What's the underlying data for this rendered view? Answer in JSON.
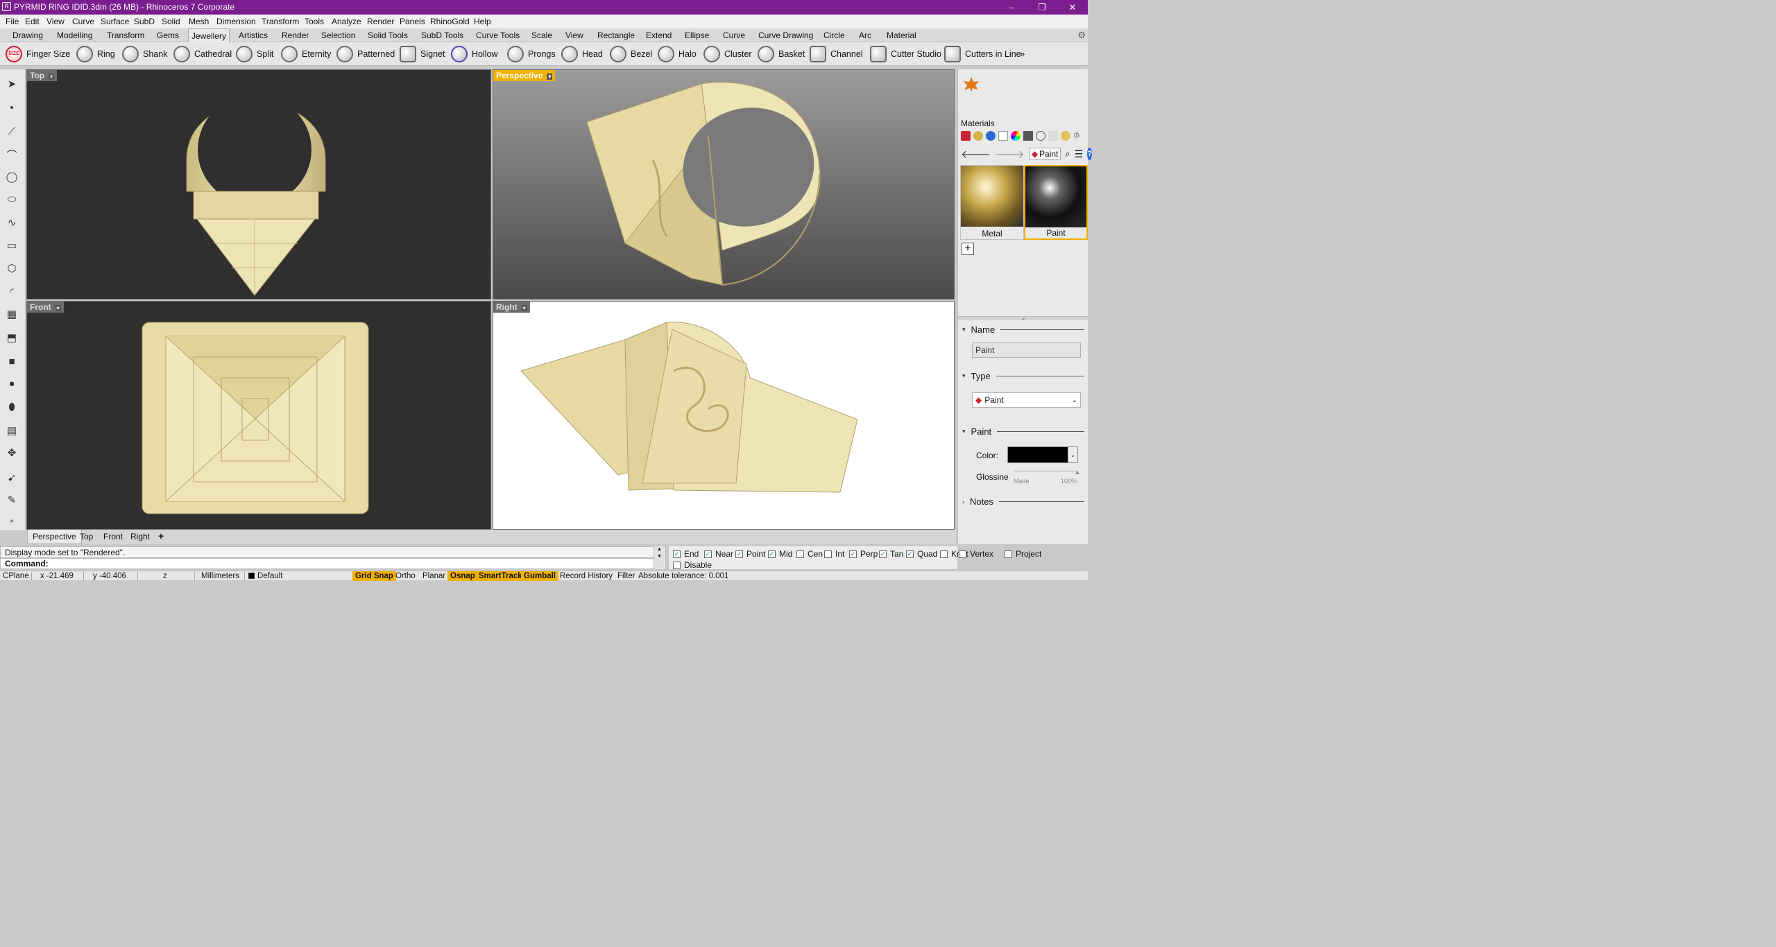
{
  "title_bar": {
    "title": "PYRMID RING IDID.3dm (26 MB) - Rhinoceros 7 Corporate",
    "minimize": "–",
    "maximize": "❐",
    "close": "✕"
  },
  "menu": [
    "File",
    "Edit",
    "View",
    "Curve",
    "Surface",
    "SubD",
    "Solid",
    "Mesh",
    "Dimension",
    "Transform",
    "Tools",
    "Analyze",
    "Render",
    "Panels",
    "RhinoGold",
    "Help"
  ],
  "toolbar_tabs": [
    "Drawing",
    "Modelling",
    "Transform",
    "Gems",
    "Jewellery",
    "Artistics",
    "Render",
    "Selection",
    "Solid Tools",
    "SubD Tools",
    "Curve Tools",
    "Scale",
    "View",
    "Rectangle",
    "Extend",
    "Ellipse",
    "Curve",
    "Curve Drawing",
    "Circle",
    "Arc",
    "Material"
  ],
  "active_tab": "Jewellery",
  "tools": [
    "Finger Size",
    "Ring",
    "Shank",
    "Cathedral",
    "Split",
    "Eternity",
    "Patterned",
    "Signet",
    "Hollow",
    "Prongs",
    "Head",
    "Bezel",
    "Halo",
    "Cluster",
    "Basket",
    "Channel",
    "Cutter Studio",
    "Cutters in Line"
  ],
  "tools_more": "»",
  "finger_size_badge": "SIZE",
  "viewports": {
    "top": {
      "title": "Top",
      "caret": "▾"
    },
    "perspective": {
      "title": "Perspective",
      "caret": "▾"
    },
    "front": {
      "title": "Front",
      "caret": "▾"
    },
    "right": {
      "title": "Right",
      "caret": "▾"
    }
  },
  "viewport_tabs": [
    "Perspective",
    "Top",
    "Front",
    "Right"
  ],
  "viewport_tab_add": "+",
  "command": {
    "history": "Display mode set to \"Rendered\".",
    "prompt": "Command:"
  },
  "osnap": {
    "items": [
      {
        "label": "End",
        "checked": true
      },
      {
        "label": "Near",
        "checked": true
      },
      {
        "label": "Point",
        "checked": true
      },
      {
        "label": "Mid",
        "checked": true
      },
      {
        "label": "Cen",
        "checked": false
      },
      {
        "label": "Int",
        "checked": false
      },
      {
        "label": "Perp",
        "checked": true
      },
      {
        "label": "Tan",
        "checked": true
      },
      {
        "label": "Quad",
        "checked": true
      },
      {
        "label": "Knot",
        "checked": false
      },
      {
        "label": "Vertex",
        "checked": false
      },
      {
        "label": "Project",
        "checked": false
      }
    ],
    "disable": "Disable"
  },
  "status": {
    "cplane": "CPlane",
    "x": "x -21.469",
    "y": "y -40.406",
    "z": "z",
    "units": "Millimeters",
    "layer": "Default",
    "panes": [
      {
        "label": "Grid Snap",
        "on": true
      },
      {
        "label": "Ortho",
        "on": false
      },
      {
        "label": "Planar",
        "on": false
      },
      {
        "label": "Osnap",
        "on": true
      },
      {
        "label": "SmartTrack",
        "on": true
      },
      {
        "label": "Gumball",
        "on": true
      },
      {
        "label": "Record History",
        "on": false
      },
      {
        "label": "Filter",
        "on": false
      }
    ],
    "tolerance": "Absolute tolerance: 0.001"
  },
  "right_panel": {
    "materials_label": "Materials",
    "nav_back": "🡐",
    "nav_forward": "🡒",
    "nav_paint": "Paint",
    "swatches": [
      {
        "label": "Metal",
        "selected": false
      },
      {
        "label": "Paint",
        "selected": true
      }
    ],
    "add_button": "+",
    "collapse": "⌄",
    "name_header": "Name",
    "name_value": "Paint",
    "type_header": "Type",
    "type_value": "Paint",
    "paint_header": "Paint",
    "color_label": "Color:",
    "color_value": "#000000",
    "glossiness_label": "Glossine",
    "gloss_min": "Matte",
    "gloss_max": "100%",
    "glossiness_level": 1.0,
    "notes_header": "Notes"
  },
  "colors": {
    "title_bar": "#7a1d8f",
    "active_viewport": "#f0b000",
    "gold": "#e8dcab"
  }
}
